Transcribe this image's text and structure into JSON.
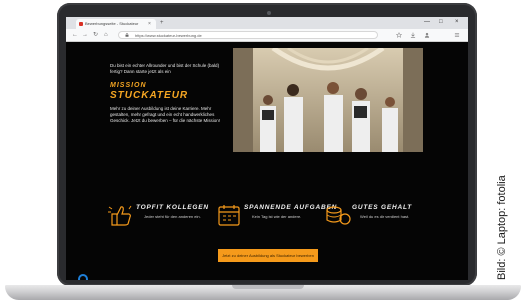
{
  "browser": {
    "tab_title": "Bewerbungsseite - Stuckateur",
    "new_tab_symbol": "+",
    "close_symbol": "×",
    "url": "https://www.stuckateur-bewerbung.de",
    "window_controls": [
      "—",
      "□",
      "×"
    ],
    "nav": {
      "back": "←",
      "forward": "→",
      "reload": "↻",
      "home": "⌂"
    }
  },
  "page": {
    "intro": "Du bist ein echter Allrounder und bist der Schule (bald) fertig? Dann starte jetzt als ein",
    "headline_small": "MISSION",
    "headline_big": "STUCKATEUR",
    "body": "Mehr zu deiner Ausbildung ist deine Karriere. Mehr gestalten, mehr gefragt und ein echt handwerkliches Geschick. Jetzt du bewerben – für die nächste Mission!",
    "features": [
      {
        "title": "TOPFIT KOLLEGEN",
        "text": "Jeder steht für den anderen ein."
      },
      {
        "title": "SPANNENDE AUFGABEN",
        "text": "Kein Tag ist wie der andere."
      },
      {
        "title": "GUTES GEHALT",
        "text": "Weil du es dir verdient hast."
      }
    ],
    "cta_label": "Jetzt zu deiner Ausbildung als Stuckateur bewerben"
  },
  "credit": "Bild: © Laptop: fotolia",
  "colors": {
    "accent": "#f59a1b",
    "page_bg": "#050505",
    "chat": "#1e7fd8"
  }
}
